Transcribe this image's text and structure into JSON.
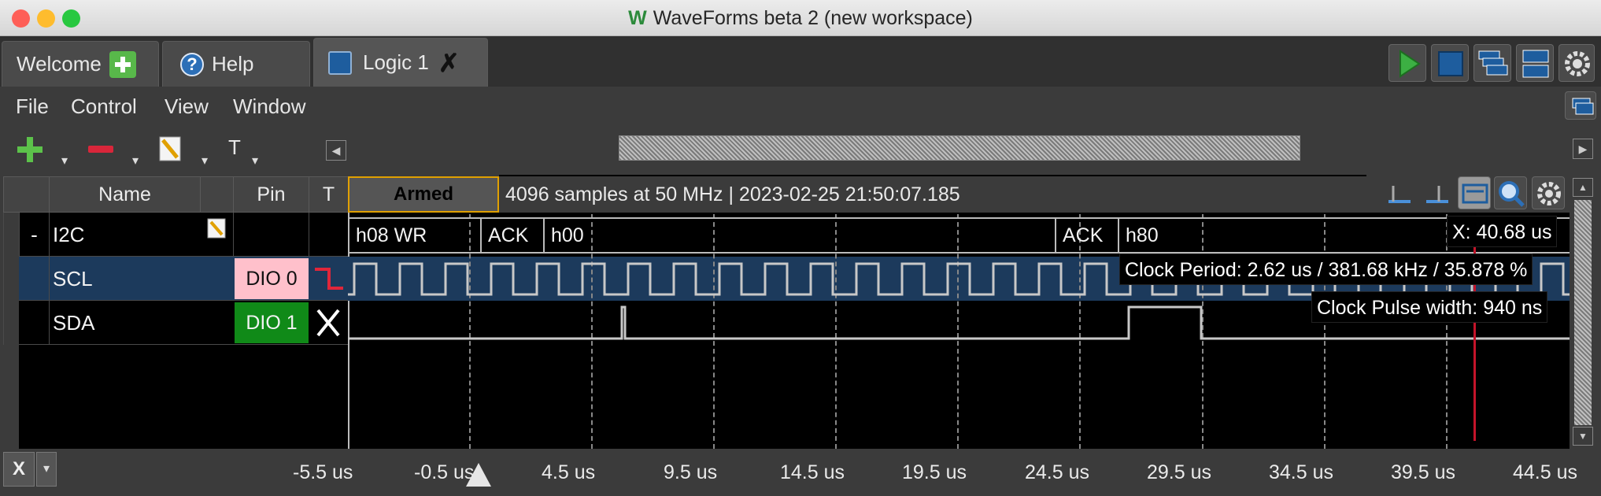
{
  "window": {
    "title": "WaveForms beta 2 (new workspace)"
  },
  "tabs": [
    {
      "label": "Welcome"
    },
    {
      "label": "Help"
    },
    {
      "label": "Logic 1"
    }
  ],
  "menu": [
    "File",
    "Control",
    "View",
    "Window"
  ],
  "toolbar": {
    "trigger_label": "T"
  },
  "status": {
    "armed": "Armed",
    "info": "4096 samples at 50 MHz | 2023-02-25 21:50:07.185"
  },
  "table": {
    "headers": {
      "name": "Name",
      "pin": "Pin",
      "trigger": "T"
    },
    "rows": [
      {
        "expand": "-",
        "name": "I2C",
        "pin": ""
      },
      {
        "name": "SCL",
        "pin": "DIO  0"
      },
      {
        "name": "SDA",
        "pin": "DIO  1"
      }
    ]
  },
  "decoder": {
    "labels": [
      "h08 WR",
      "ACK",
      "h00",
      "ACK",
      "h80"
    ]
  },
  "cursor": {
    "x_readout": "X: 40.68 us",
    "clock_period": "Clock Period: 2.62 us / 381.68 kHz / 35.878 %",
    "pulse_width": "Clock Pulse width: 940 ns"
  },
  "axis": {
    "ticks": [
      "-5.5 us",
      "-0.5 us",
      "4.5 us",
      "9.5 us",
      "14.5 us",
      "19.5 us",
      "24.5 us",
      "29.5 us",
      "34.5 us",
      "39.5 us",
      "44.5 us"
    ],
    "x_button": "X"
  },
  "colors": {
    "scl_pin": "#ffc0cb",
    "sda_pin": "#108a18",
    "scl_row": "#1c3a5c",
    "cursor": "#c4142a"
  }
}
